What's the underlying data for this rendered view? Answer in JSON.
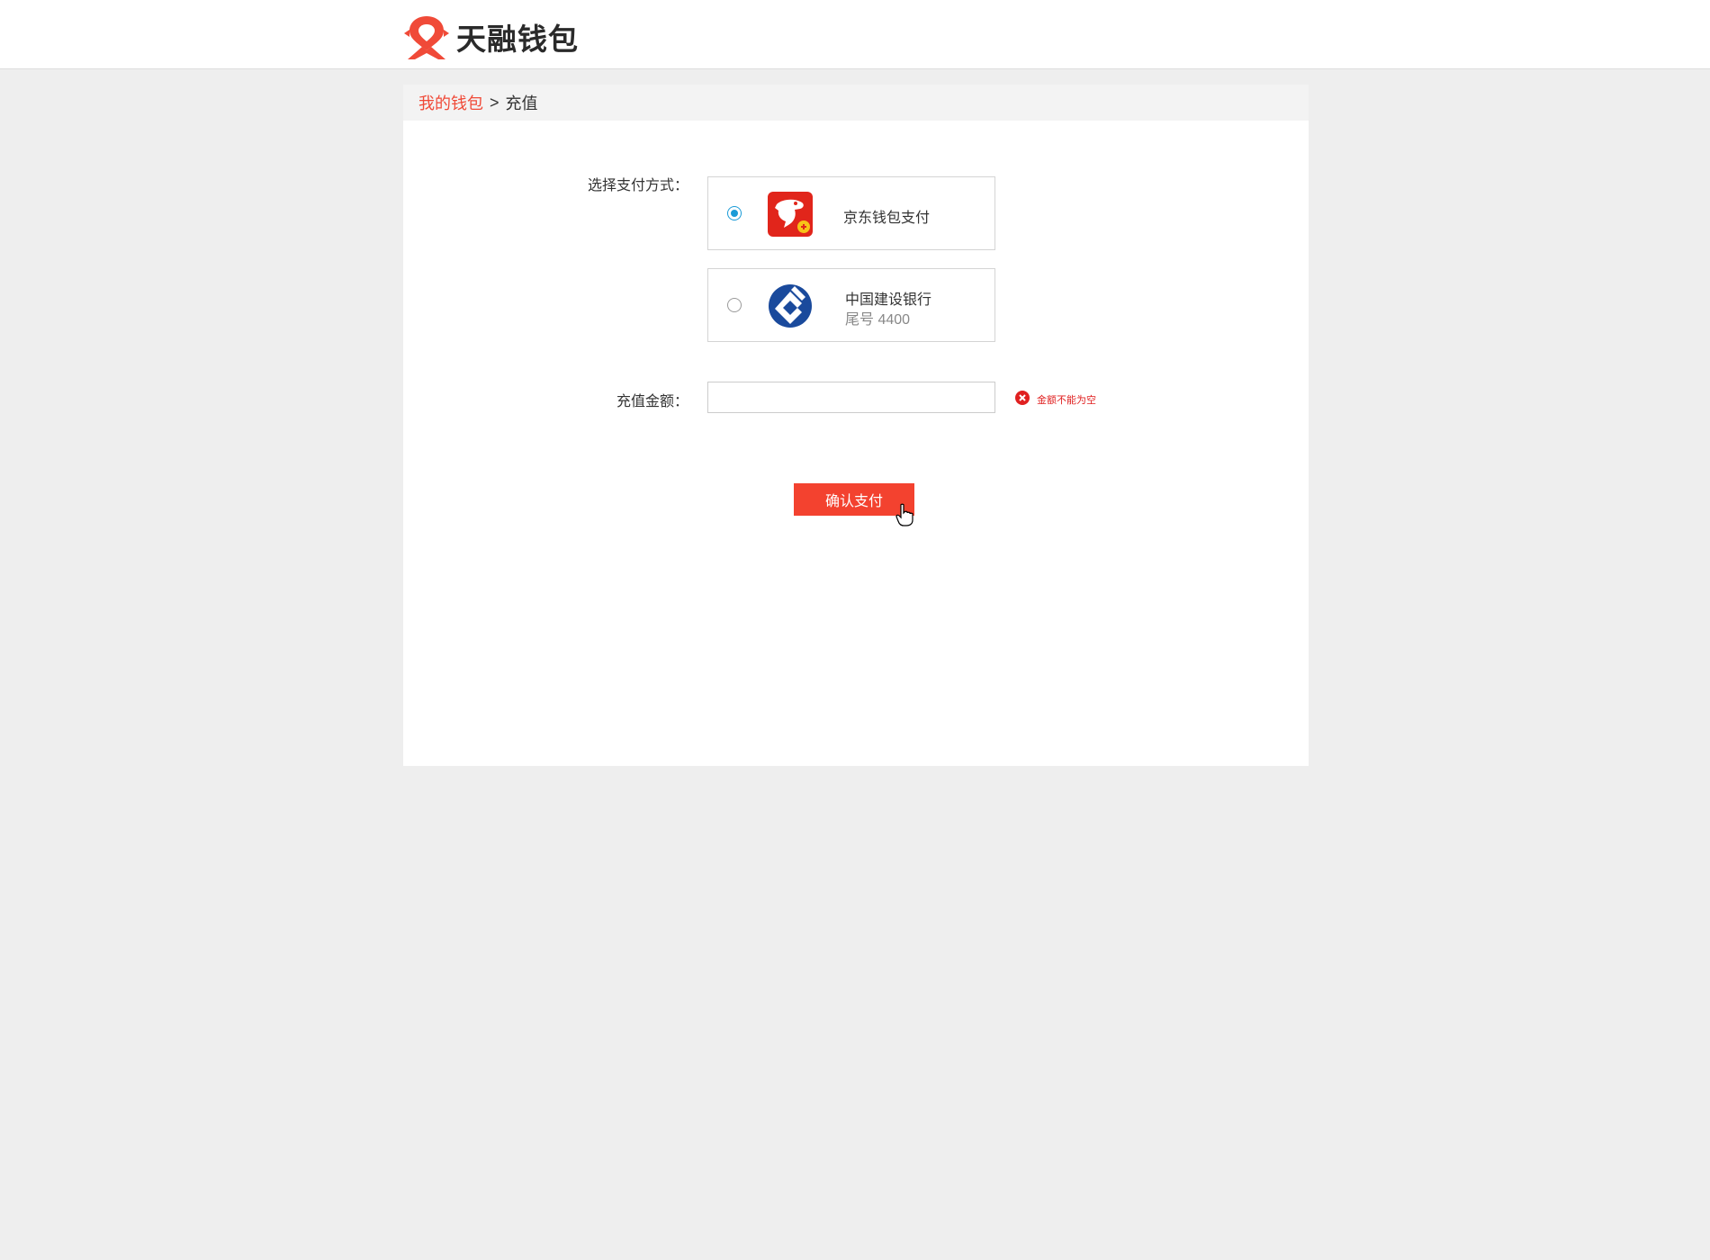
{
  "header": {
    "logo_text": "天融钱包",
    "brand_color": "#f04a38"
  },
  "breadcrumb": {
    "link": "我的钱包",
    "separator": ">",
    "current": "充值"
  },
  "form": {
    "pay_method_label": "选择支付方式：",
    "options": [
      {
        "name": "京东钱包支付",
        "sub": "",
        "selected": true,
        "icon": "jd-wallet-icon"
      },
      {
        "name": "中国建设银行",
        "sub": "尾号 4400",
        "selected": false,
        "icon": "ccb-bank-icon"
      }
    ],
    "amount_label": "充值金额：",
    "amount_value": "",
    "amount_placeholder": "",
    "error_text": "金额不能为空",
    "submit_label": "确认支付"
  }
}
